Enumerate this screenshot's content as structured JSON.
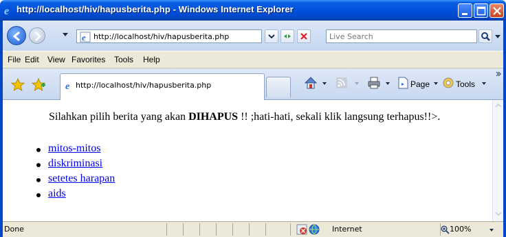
{
  "window": {
    "title": "http://localhost/hiv/hapusberita.php - Windows Internet Explorer"
  },
  "address_bar": {
    "url": "http://localhost/hiv/hapusberita.php"
  },
  "search": {
    "placeholder": "Live Search"
  },
  "menu": {
    "items": [
      "File",
      "Edit",
      "View",
      "Favorites",
      "Tools",
      "Help"
    ]
  },
  "tab": {
    "label": "http://localhost/hiv/hapusberita.php"
  },
  "toolbar": {
    "page_label": "Page",
    "tools_label": "Tools"
  },
  "content": {
    "msg_prefix": "Silahkan pilih berita yang akan ",
    "msg_bold": "DIHAPUS",
    "msg_suffix": " !! ;hati-hati, sekali klik langsung terhapus!!>.",
    "links": [
      "mitos-mitos",
      "diskriminasi",
      "setetes harapan",
      "aids"
    ]
  },
  "statusbar": {
    "status": "Done",
    "zone": "Internet",
    "zoom": "100%"
  },
  "colors": {
    "titlebar": "#0051dc",
    "link": "#0000ee"
  }
}
